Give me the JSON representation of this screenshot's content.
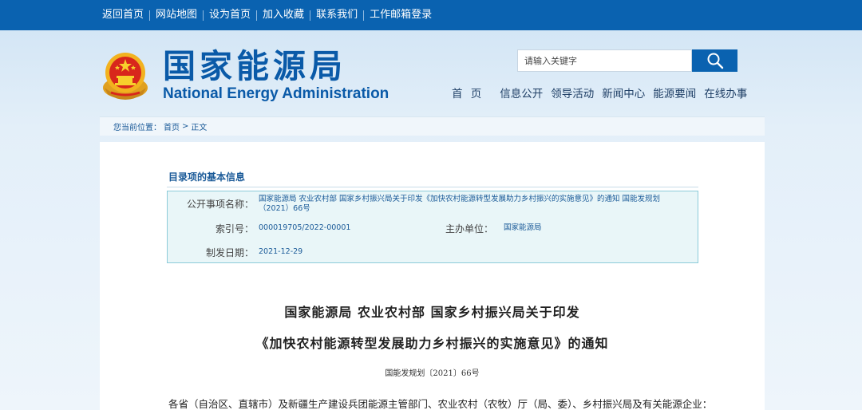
{
  "topbar": {
    "links": [
      "返回首页",
      "网站地图",
      "设为首页",
      "加入收藏",
      "联系我们",
      "工作邮箱登录"
    ]
  },
  "header": {
    "title_cn": "国家能源局",
    "title_en": "National Energy Administration",
    "emblem_icon": "national-emblem-icon"
  },
  "search": {
    "placeholder": "请输入关键字",
    "icon": "magnifier-icon"
  },
  "nav": {
    "items": [
      "首 页",
      "信息公开",
      "领导活动",
      "新闻中心",
      "能源要闻",
      "在线办事"
    ]
  },
  "breadcrumb": {
    "prefix": "您当前位置：",
    "home": "首页",
    "separator": ">",
    "current": "正文"
  },
  "info": {
    "section_title": "目录项的基本信息",
    "rows": {
      "name_label": "公开事项名称：",
      "name_value": "国家能源局 农业农村部 国家乡村振兴局关于印发《加快农村能源转型发展助力乡村振兴的实施意见》的通知 国能发规划（2021）66号",
      "index_label": "索引号：",
      "index_value": "000019705/2022-00001",
      "host_label": "主办单位：",
      "host_value": "国家能源局",
      "date_label": "制发日期：",
      "date_value": "2021-12-29"
    }
  },
  "document": {
    "title_line1": "国家能源局 农业农村部 国家乡村振兴局关于印发",
    "title_line2": "《加快农村能源转型发展助力乡村振兴的实施意见》的通知",
    "number": "国能发规划〔2021〕66号",
    "salutation": "各省（自治区、直辖市）及新疆生产建设兵团能源主管部门、农业农村（农牧）厅（局、委）、乡村振兴局及有关能源企业："
  },
  "colors": {
    "brand_blue": "#0a62b0",
    "link_blue": "#1a5a98",
    "info_bg": "#e9f6f8",
    "info_border": "#8ccbd9"
  }
}
